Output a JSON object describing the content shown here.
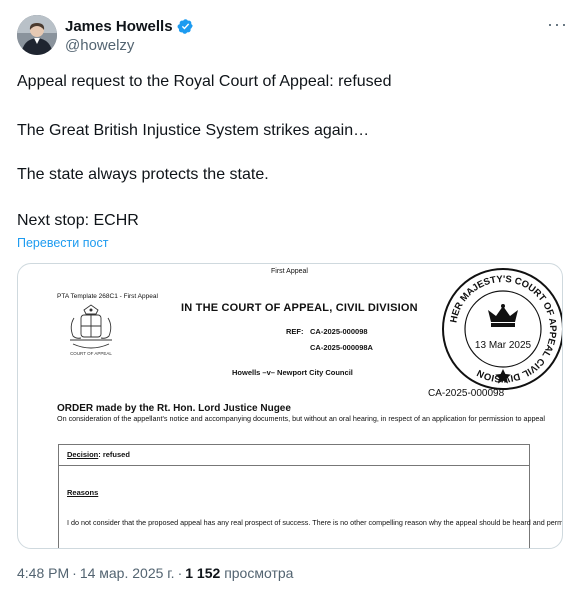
{
  "author": {
    "name": "James Howells",
    "handle": "@howelzy",
    "verified_color": "#1d9bf0"
  },
  "tweet": {
    "lines": [
      "Appeal request to the Royal Court of Appeal: refused",
      "The Great British Injustice System strikes again…",
      "The state always protects the state.",
      "Next stop: ECHR"
    ],
    "translate_link": "Перевести пост"
  },
  "document": {
    "first_appeal": "First Appeal",
    "pta_template": "PTA Template 268C1 - First Appeal",
    "court_title": "IN THE COURT OF APPEAL, CIVIL DIVISION",
    "ref_label": "REF:",
    "ref_1": "CA-2025-000098",
    "ref_2": "CA-2025-000098A",
    "parties": "Howells   –v–   Newport City Council",
    "crest_caption": "COURT OF APPEAL",
    "stamp": {
      "ring_text": "HER MAJESTY'S COURT OF APPEAL CIVIL DIVISION",
      "date": "13 Mar 2025",
      "ref": "CA-2025-000098"
    },
    "order_title": "ORDER made by the Rt. Hon. Lord Justice  Nugee",
    "order_body": "On consideration of the appellant's notice and accompanying documents, but without an oral hearing, in respect of an application for permission to appeal",
    "decision_label": "Decision",
    "decision_value": ":  refused",
    "reasons_label": "Reasons",
    "reasons_body": "I do not consider that the proposed appeal has any real prospect of success.  There is no other compelling reason why the appeal should be heard and permission must therefore be refused."
  },
  "meta": {
    "time": "4:48 PM",
    "date": "14 мар. 2025 г.",
    "views_count": "1 152",
    "views_label": "просмотра"
  },
  "colors": {
    "text": "#0f1419",
    "secondary": "#536471",
    "link": "#1d9bf0",
    "border": "#cfd9de"
  },
  "icons": {
    "verified": "verified-badge-icon",
    "more": "more-horizontal-icon",
    "crest": "royal-crest-icon",
    "crown": "crown-icon",
    "star": "star-icon"
  }
}
